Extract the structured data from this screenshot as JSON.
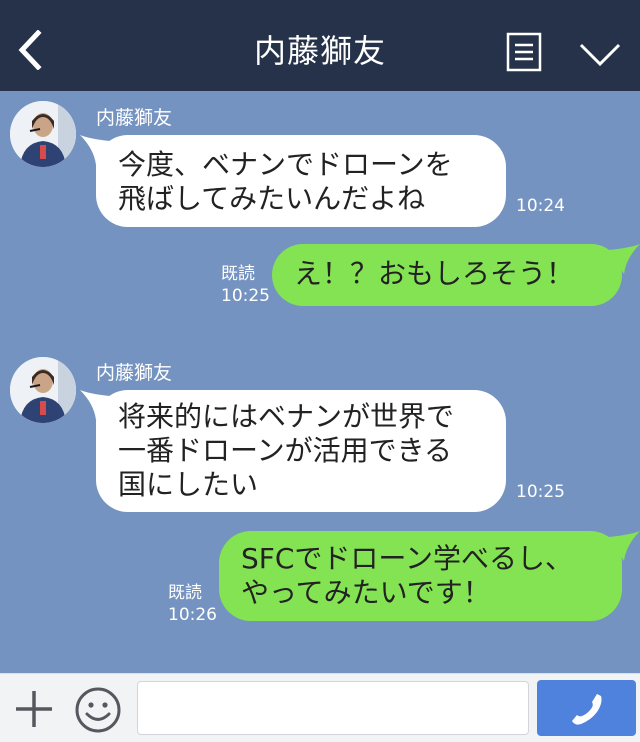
{
  "header": {
    "title": "内藤獅友",
    "back_icon": "chevron-left-icon",
    "menu_icon": "menu-icon",
    "collapse_icon": "chevron-down-icon"
  },
  "messages": [
    {
      "side": "left",
      "sender": "内藤獅友",
      "lines": [
        "今度、ベナンでドローンを",
        "飛ばしてみたいんだよね"
      ],
      "time": "10:24"
    },
    {
      "side": "right",
      "read": "既読",
      "lines": [
        "え！？おもしろそう！"
      ],
      "time": "10:25"
    },
    {
      "side": "left",
      "sender": "内藤獅友",
      "lines": [
        "将来的にはベナンが世界で",
        "一番ドローンが活用できる",
        "国にしたい"
      ],
      "time": "10:25"
    },
    {
      "side": "right",
      "read": "既読",
      "lines": [
        "SFCでドローン学べるし、",
        "やってみたいです！"
      ],
      "time": "10:26"
    }
  ],
  "footer": {
    "plus_icon": "plus-icon",
    "emoji_icon": "smiley-icon",
    "input_value": "",
    "input_placeholder": "",
    "call_icon": "phone-icon"
  },
  "colors": {
    "header_bg": "#263249",
    "chat_bg": "#7593c0",
    "bubble_self": "#84e352",
    "bubble_other": "#ffffff",
    "call_button": "#4f82dc"
  }
}
